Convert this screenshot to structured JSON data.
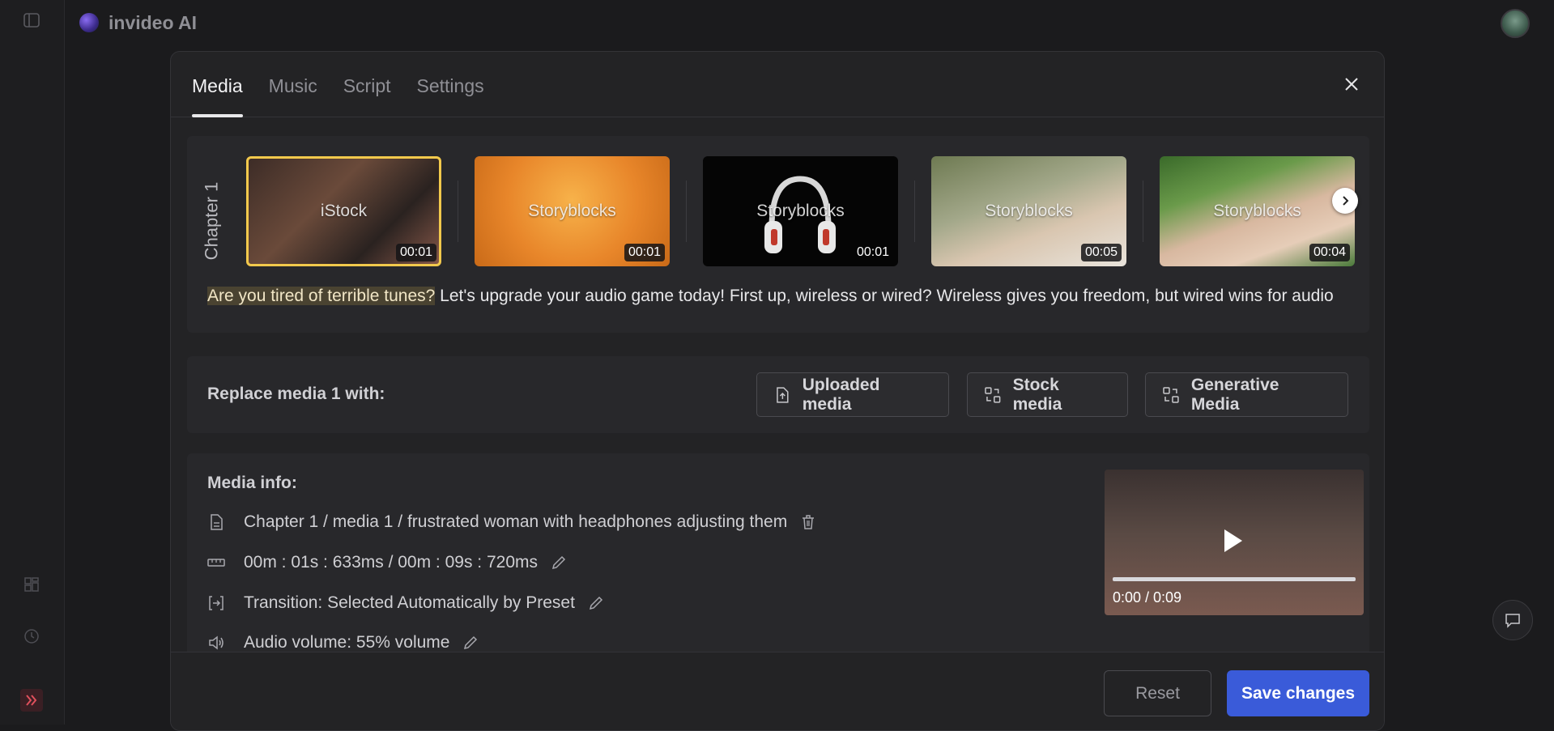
{
  "app": {
    "name": "invideo AI"
  },
  "tabs": [
    {
      "label": "Media",
      "active": true
    },
    {
      "label": "Music",
      "active": false
    },
    {
      "label": "Script",
      "active": false
    },
    {
      "label": "Settings",
      "active": false
    }
  ],
  "chapter": {
    "label": "Chapter 1",
    "media": [
      {
        "source": "iStock",
        "duration": "00:01",
        "selected": true
      },
      {
        "source": "Storyblocks",
        "duration": "00:01",
        "selected": false
      },
      {
        "source": "Storyblocks",
        "duration": "00:01",
        "selected": false
      },
      {
        "source": "Storyblocks",
        "duration": "00:05",
        "selected": false
      },
      {
        "source": "Storyblocks",
        "duration": "00:04",
        "selected": false
      }
    ],
    "script_highlight": "Are you tired of terrible tunes?",
    "script_rest": " Let's upgrade your audio game today! First up, wireless or wired? Wireless gives you freedom, but wired wins for audio"
  },
  "replace": {
    "label": "Replace media 1 with:",
    "uploaded": "Uploaded media",
    "stock": "Stock media",
    "generative": "Generative Media"
  },
  "media_info": {
    "label": "Media info:",
    "path": "Chapter 1 / media 1 / frustrated woman with headphones adjusting them",
    "timing": "00m : 01s : 633ms / 00m : 09s : 720ms",
    "transition": "Transition: Selected Automatically by Preset",
    "audio": "Audio volume: 55% volume",
    "preview_time": "0:00 / 0:09",
    "preview_progress": 0
  },
  "footer": {
    "reset": "Reset",
    "save": "Save changes"
  },
  "colors": {
    "accent": "#3a5bd9",
    "selected_border": "#f2c94c",
    "highlight_bg": "#4a4331"
  },
  "icons": [
    "sidebar-toggle-icon",
    "grid-icon",
    "history-icon",
    "expand-icon",
    "close-icon",
    "chevron-right-icon",
    "upload-icon",
    "swap-icon",
    "file-icon",
    "trash-icon",
    "ruler-icon",
    "pencil-icon",
    "transition-icon",
    "speaker-icon",
    "play-icon",
    "chat-icon"
  ]
}
